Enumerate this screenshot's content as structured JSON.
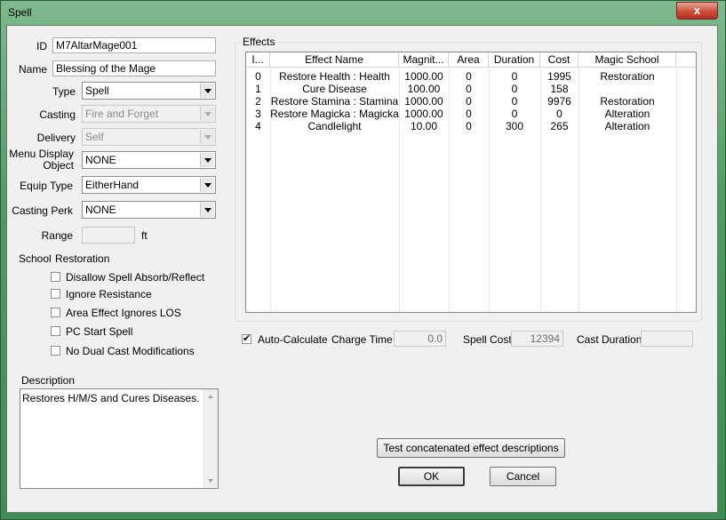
{
  "window": {
    "title": "Spell",
    "close_glyph": "x"
  },
  "form": {
    "id_label": "ID",
    "id_value": "M7AltarMage001",
    "name_label": "Name",
    "name_value": "Blessing of the Mage",
    "type_label": "Type",
    "type_value": "Spell",
    "casting_label": "Casting",
    "casting_value": "Fire and Forget",
    "delivery_label": "Delivery",
    "delivery_value": "Self",
    "menu_display_label_1": "Menu Display",
    "menu_display_label_2": "Object",
    "menu_display_value": "NONE",
    "equip_type_label": "Equip Type",
    "equip_type_value": "EitherHand",
    "casting_perk_label": "Casting Perk",
    "casting_perk_value": "NONE",
    "range_label": "Range",
    "range_value": "",
    "range_unit": "ft",
    "school_label": "School",
    "school_value": "Restoration"
  },
  "checkboxes": [
    {
      "label": "Disallow Spell Absorb/Reflect",
      "checked": false
    },
    {
      "label": "Ignore Resistance",
      "checked": false
    },
    {
      "label": "Area Effect Ignores LOS",
      "checked": false
    },
    {
      "label": "PC Start Spell",
      "checked": false
    },
    {
      "label": "No Dual Cast Modifications",
      "checked": false
    }
  ],
  "description": {
    "label": "Description",
    "text": "Restores H/M/S and Cures Diseases."
  },
  "effects": {
    "group_label": "Effects",
    "columns": [
      "I...",
      "Effect Name",
      "Magnit...",
      "Area",
      "Duration",
      "Cost",
      "Magic School"
    ],
    "rows": [
      [
        "0",
        "Restore Health : Health",
        "1000.00",
        "0",
        "0",
        "1995",
        "Restoration"
      ],
      [
        "1",
        "Cure Disease",
        "100.00",
        "0",
        "0",
        "158",
        ""
      ],
      [
        "2",
        "Restore Stamina : Stamina",
        "1000.00",
        "0",
        "0",
        "9976",
        "Restoration"
      ],
      [
        "3",
        "Restore Magicka : Magicka",
        "1000.00",
        "0",
        "0",
        "0",
        "Alteration"
      ],
      [
        "4",
        "Candlelight",
        "10.00",
        "0",
        "300",
        "265",
        "Alteration"
      ]
    ]
  },
  "calc": {
    "auto_calculate_label": "Auto-Calculate",
    "auto_calculate_checked": true,
    "charge_time_label": "Charge Time",
    "charge_time_value": "0.0",
    "spell_cost_label": "Spell Cost",
    "spell_cost_value": "12394",
    "cast_duration_label": "Cast Duration",
    "cast_duration_value": ""
  },
  "buttons": {
    "test_label": "Test concatenated effect descriptions",
    "ok_label": "OK",
    "cancel_label": "Cancel"
  }
}
